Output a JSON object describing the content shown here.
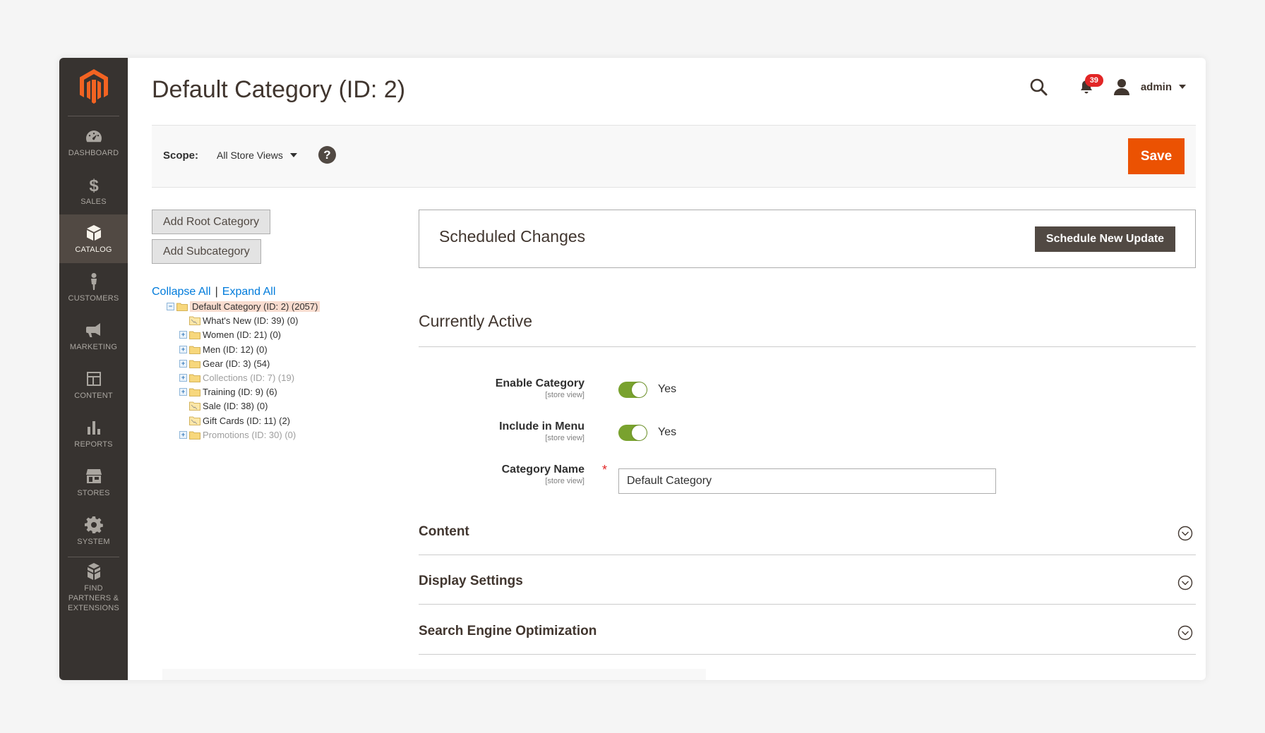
{
  "header": {
    "title": "Default Category (ID: 2)",
    "notifications_count": "39",
    "user_name": "admin"
  },
  "sidebar": {
    "items": [
      {
        "label": "Dashboard",
        "icon": "dashboard-icon"
      },
      {
        "label": "Sales",
        "icon": "dollar-icon"
      },
      {
        "label": "Catalog",
        "icon": "cube-icon",
        "active": true
      },
      {
        "label": "Customers",
        "icon": "person-icon"
      },
      {
        "label": "Marketing",
        "icon": "megaphone-icon"
      },
      {
        "label": "Content",
        "icon": "layout-icon"
      },
      {
        "label": "Reports",
        "icon": "bar-chart-icon"
      },
      {
        "label": "Stores",
        "icon": "store-icon"
      },
      {
        "label": "System",
        "icon": "gear-icon"
      },
      {
        "label": "Find Partners & Extensions",
        "icon": "boxes-icon"
      }
    ]
  },
  "scope": {
    "label": "Scope:",
    "value": "All Store Views",
    "save_label": "Save"
  },
  "tree_panel": {
    "add_root_label": "Add Root Category",
    "add_sub_label": "Add Subcategory",
    "collapse_all": "Collapse All",
    "separator": "|",
    "expand_all": "Expand All",
    "nodes": [
      {
        "label": "Default Category (ID: 2) (2057)",
        "expander": "minus",
        "selected": true,
        "muted": false
      },
      {
        "label": "What's New (ID: 39) (0)",
        "expander": "none",
        "muted": false
      },
      {
        "label": "Women (ID: 21) (0)",
        "expander": "plus",
        "muted": false
      },
      {
        "label": "Men (ID: 12) (0)",
        "expander": "plus",
        "muted": false
      },
      {
        "label": "Gear (ID: 3) (54)",
        "expander": "plus",
        "muted": false
      },
      {
        "label": "Collections (ID: 7) (19)",
        "expander": "plus",
        "muted": true
      },
      {
        "label": "Training (ID: 9) (6)",
        "expander": "plus",
        "muted": false
      },
      {
        "label": "Sale (ID: 38) (0)",
        "expander": "none",
        "muted": false
      },
      {
        "label": "Gift Cards (ID: 11) (2)",
        "expander": "none",
        "muted": false
      },
      {
        "label": "Promotions (ID: 30) (0)",
        "expander": "plus",
        "muted": true
      }
    ]
  },
  "scheduled": {
    "title": "Scheduled Changes",
    "button_label": "Schedule New Update"
  },
  "active": {
    "title": "Currently Active",
    "fields": {
      "enable": {
        "label": "Enable Category",
        "scope": "[store view]",
        "value": "Yes"
      },
      "menu": {
        "label": "Include in Menu",
        "scope": "[store view]",
        "value": "Yes"
      },
      "name": {
        "label": "Category Name",
        "scope": "[store view]",
        "required_mark": "*",
        "value": "Default Category"
      }
    }
  },
  "sections": [
    {
      "title": "Content"
    },
    {
      "title": "Display Settings"
    },
    {
      "title": "Search Engine Optimization"
    }
  ],
  "colors": {
    "sidebar_bg": "#373330",
    "accent": "#eb5202",
    "toggle_on": "#79a22e",
    "link": "#007bdb"
  }
}
